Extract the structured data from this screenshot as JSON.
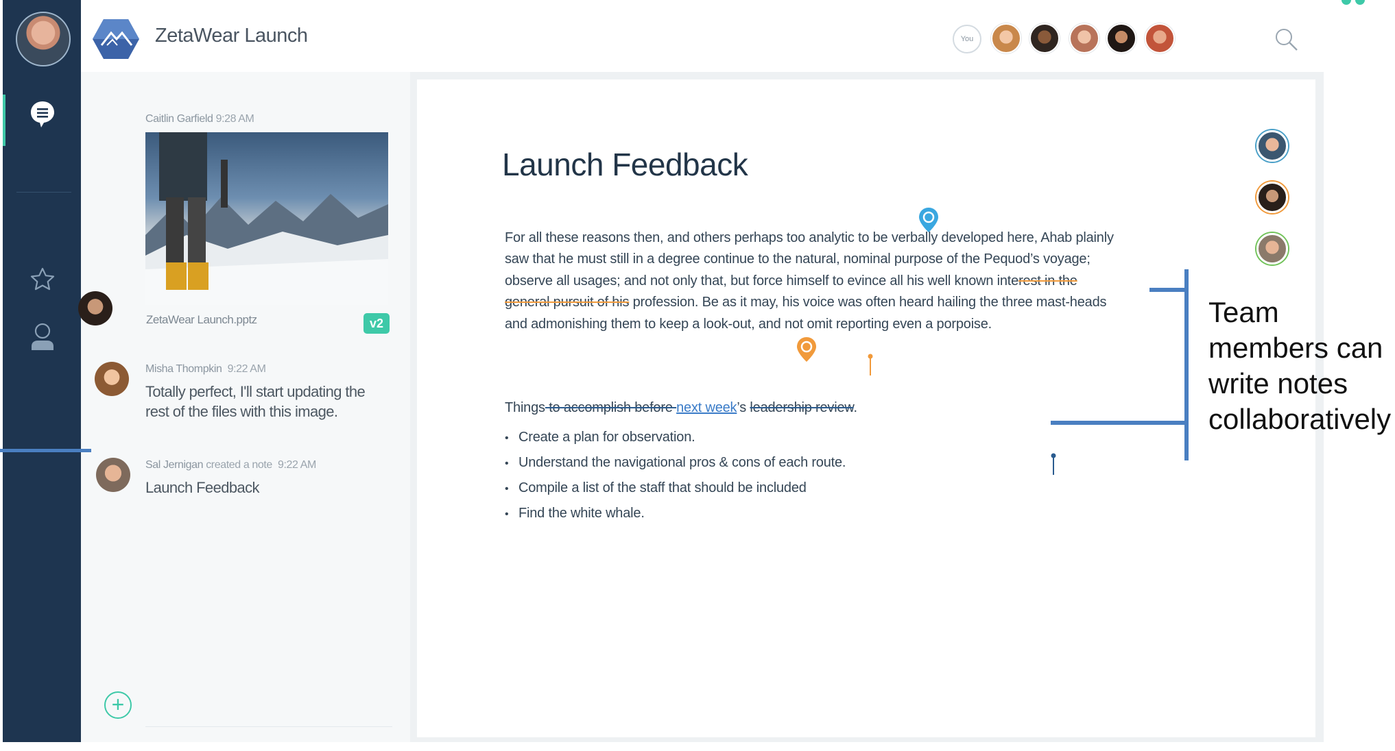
{
  "colors": {
    "rail": "#1e3550",
    "accent": "#3ec9a8",
    "callout_blue": "#4a7fc1",
    "cursor_blue": "#3aa7e0",
    "cursor_orange": "#f19a3b"
  },
  "header": {
    "app_title": "ZetaWear Launch",
    "you_label": "You",
    "search_icon": "search-icon"
  },
  "rail": {
    "icons": [
      "chat-bubble-icon",
      "star-icon",
      "person-icon"
    ]
  },
  "feed": {
    "items": [
      {
        "author": "Caitlin Garfield",
        "time": "9:28 AM",
        "attachment": "ZetaWear Launch.pptz",
        "version": "v2"
      },
      {
        "author": "Misha Thompkin",
        "time": "9:22 AM",
        "message": "Totally perfect, I'll start updating the rest of the files with this image."
      },
      {
        "author": "Sal Jernigan",
        "action": "created a note",
        "time": "9:22 AM",
        "message": "Launch Feedback"
      }
    ],
    "add_icon": "plus-circle-icon"
  },
  "document": {
    "title": "Launch Feedback",
    "para1_a": "For all these reasons then, and others perhaps too analytic to be verbally developed here, Ahab plainly saw that he must still in a degree continue to the natural, nominal purpose of the Pequod’s voyage; observe all usages; and not only that, but force himself to evince all his well known inte",
    "para1_strike": "rest in the general pursuit of his",
    "para1_b": " profession. Be as it may, his voice was often heard hailing the three mast-heads and admonishing them to keep a look-out, and not omit reporting even a porpoise.",
    "task_a": "Things",
    "task_strike1": " to accomplish before ",
    "task_link": "next week",
    "task_b": "’s ",
    "task_strike2": "leadership review",
    "task_c": ".",
    "bullets": [
      "Create a plan for observation.",
      "Understand the navigational pros & cons of each route.",
      "Compile a list of the staff that should be included",
      "Find the white whale."
    ]
  },
  "callout": {
    "line1": "Team",
    "line2": "members can",
    "line3": "write notes",
    "line4": "collaboratively"
  }
}
